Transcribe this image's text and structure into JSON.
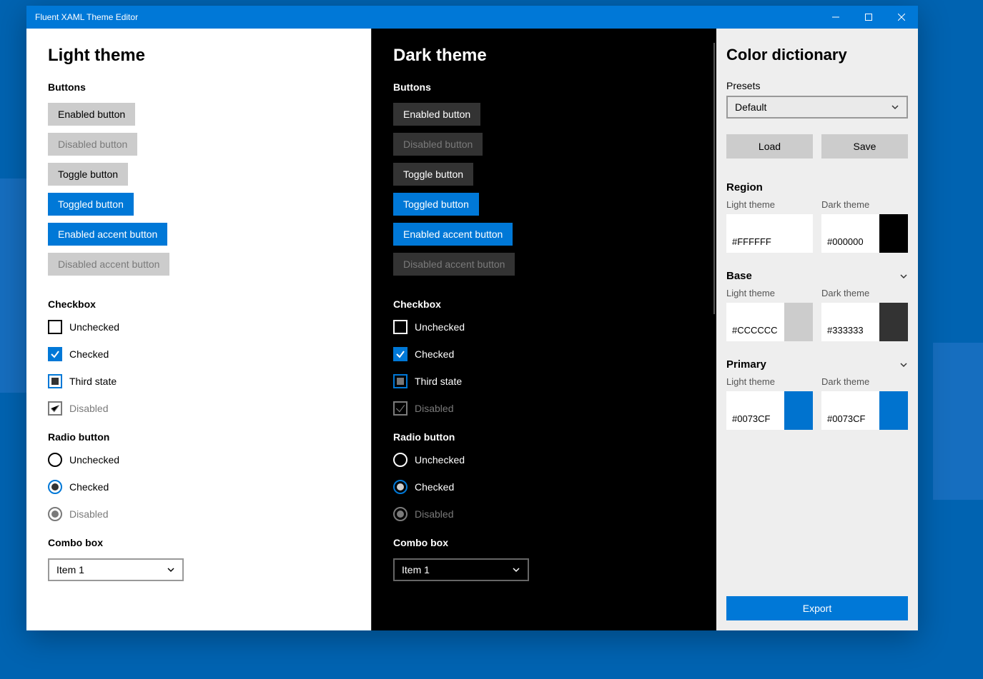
{
  "window": {
    "title": "Fluent XAML Theme Editor"
  },
  "themes": {
    "light_title": "Light theme",
    "dark_title": "Dark theme",
    "groups": {
      "buttons": "Buttons",
      "checkbox": "Checkbox",
      "radio": "Radio button",
      "combo": "Combo box"
    },
    "buttons": {
      "enabled": "Enabled button",
      "disabled": "Disabled button",
      "toggle": "Toggle button",
      "toggled": "Toggled button",
      "accent": "Enabled accent button",
      "accent_disabled": "Disabled accent button"
    },
    "checkbox": {
      "unchecked": "Unchecked",
      "checked": "Checked",
      "third": "Third state",
      "disabled": "Disabled"
    },
    "radio": {
      "unchecked": "Unchecked",
      "checked": "Checked",
      "disabled": "Disabled"
    },
    "combo": {
      "item": "Item 1"
    }
  },
  "sidebar": {
    "title": "Color dictionary",
    "presets_label": "Presets",
    "preset_value": "Default",
    "load": "Load",
    "save": "Save",
    "light_label": "Light theme",
    "dark_label": "Dark theme",
    "region": {
      "title": "Region",
      "light_hex": "#FFFFFF",
      "light_color": "#FFFFFF",
      "dark_hex": "#000000",
      "dark_color": "#000000"
    },
    "base": {
      "title": "Base",
      "light_hex": "#CCCCCC",
      "light_color": "#CCCCCC",
      "dark_hex": "#333333",
      "dark_color": "#333333"
    },
    "primary": {
      "title": "Primary",
      "light_hex": "#0073CF",
      "light_color": "#0073CF",
      "dark_hex": "#0073CF",
      "dark_color": "#0073CF"
    },
    "export": "Export"
  }
}
